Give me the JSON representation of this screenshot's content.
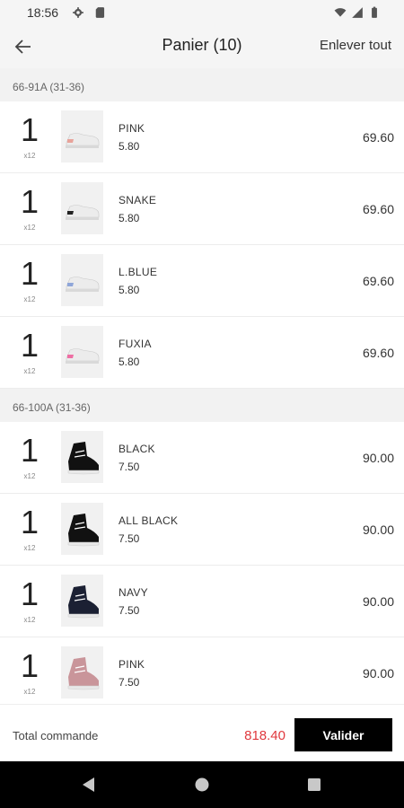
{
  "status_bar": {
    "time": "18:56",
    "icons": [
      "gear-icon",
      "sd-card-icon",
      "wifi-icon",
      "signal-icon",
      "battery-icon"
    ]
  },
  "header": {
    "title": "Panier (10)",
    "remove_all": "Enlever tout",
    "back_icon": "arrow-left-icon"
  },
  "sections": [
    {
      "label": "66-91A (31-36)",
      "items": [
        {
          "qty": "1",
          "mult": "x12",
          "name": "PINK",
          "unit_price": "5.80",
          "amount": "69.60",
          "shoe": "low",
          "accent": "#e8a39a"
        },
        {
          "qty": "1",
          "mult": "x12",
          "name": "SNAKE",
          "unit_price": "5.80",
          "amount": "69.60",
          "shoe": "low",
          "accent": "#222222"
        },
        {
          "qty": "1",
          "mult": "x12",
          "name": "L.BLUE",
          "unit_price": "5.80",
          "amount": "69.60",
          "shoe": "low",
          "accent": "#8fa6d9"
        },
        {
          "qty": "1",
          "mult": "x12",
          "name": "FUXIA",
          "unit_price": "5.80",
          "amount": "69.60",
          "shoe": "low",
          "accent": "#ee6fa4"
        }
      ]
    },
    {
      "label": "66-100A (31-36)",
      "items": [
        {
          "qty": "1",
          "mult": "x12",
          "name": "BLACK",
          "unit_price": "7.50",
          "amount": "90.00",
          "shoe": "high",
          "accent": "#111111"
        },
        {
          "qty": "1",
          "mult": "x12",
          "name": "ALL BLACK",
          "unit_price": "7.50",
          "amount": "90.00",
          "shoe": "high",
          "accent": "#111111"
        },
        {
          "qty": "1",
          "mult": "x12",
          "name": "NAVY",
          "unit_price": "7.50",
          "amount": "90.00",
          "shoe": "high",
          "accent": "#1b2033"
        },
        {
          "qty": "1",
          "mult": "x12",
          "name": "PINK",
          "unit_price": "7.50",
          "amount": "90.00",
          "shoe": "high",
          "accent": "#c9959a"
        }
      ]
    }
  ],
  "footer": {
    "total_label": "Total commande",
    "total_value": "818.40",
    "submit_label": "Valider"
  },
  "nav_bar": {
    "icons": [
      "back-triangle-icon",
      "home-circle-icon",
      "recents-square-icon"
    ]
  },
  "colors": {
    "total": "#e0393e",
    "button": "#000000",
    "section_bg": "#f2f2f2"
  }
}
